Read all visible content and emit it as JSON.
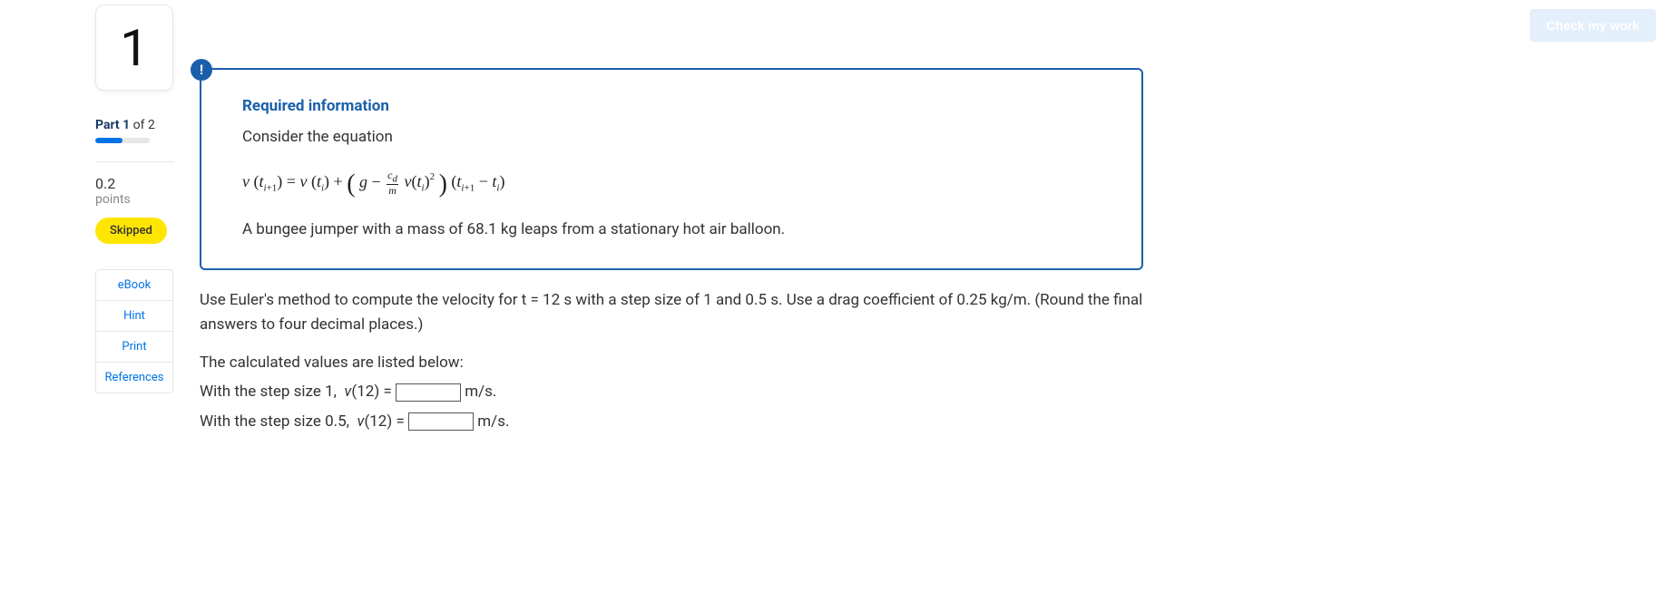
{
  "header": {
    "check_work_label": "Check my work"
  },
  "sidebar": {
    "question_number": "1",
    "part_prefix": "Part 1",
    "part_suffix": " of 2",
    "points_value": "0.2",
    "points_label": "points",
    "skipped_label": "Skipped",
    "links": {
      "ebook": "eBook",
      "hint": "Hint",
      "print": "Print",
      "references": "References"
    }
  },
  "card": {
    "badge": "!",
    "required_title": "Required information",
    "consider": "Consider the equation",
    "equation_plain": "v(t_{i+1}) = v(t_i) + ( g − (c_d / m) · v(t_i)^2 ) · (t_{i+1} − t_i)",
    "bungee_text": "A bungee jumper with a mass of 68.1 kg leaps from a stationary hot air balloon."
  },
  "question": {
    "prompt": "Use Euler's method to compute the velocity for t = 12 s with a step size of 1 and 0.5 s. Use a drag coefficient of 0.25 kg/m. (Round the final answers to four decimal places.)",
    "listed_intro": "The calculated values are listed below:",
    "line1_prefix": "With the step size 1,  v(12) = ",
    "line1_unit": " m/s.",
    "line2_prefix": "With the step size 0.5,  v(12) = ",
    "line2_unit": " m/s.",
    "answer1": "",
    "answer2": ""
  }
}
